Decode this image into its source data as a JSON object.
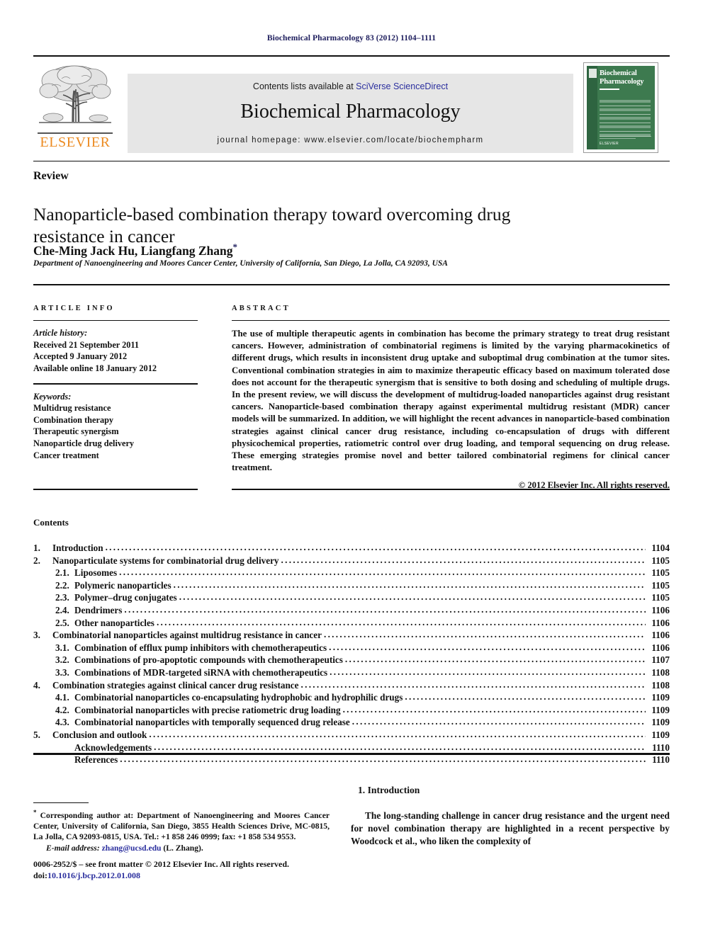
{
  "running_head": "Biochemical Pharmacology 83 (2012) 1104–1111",
  "masthead": {
    "contents_prefix": "Contents lists available at ",
    "sciencedirect_link": "SciVerse ScienceDirect",
    "journal_title": "Biochemical Pharmacology",
    "homepage": "journal homepage: www.elsevier.com/locate/biochempharm",
    "publisher_wordmark": "ELSEVIER",
    "publisher_color": "#ec8b22",
    "link_color": "#2b2f9e",
    "box_color": "#e6e6e6",
    "cover": {
      "line1": "Biochemical",
      "line2": "Pharmacology",
      "brand": "ELSEVIER",
      "bg_color": "#3d7a4f"
    }
  },
  "article": {
    "doctype": "Review",
    "title": "Nanoparticle-based combination therapy toward overcoming drug resistance in cancer",
    "authors": "Che-Ming Jack Hu, Liangfang Zhang",
    "corresponding_marker": "*",
    "affiliation": "Department of Nanoengineering and Moores Cancer Center, University of California, San Diego, La Jolla, CA 92093, USA"
  },
  "article_info": {
    "heading": "ARTICLE INFO",
    "history_label": "Article history:",
    "history": [
      "Received 21 September 2011",
      "Accepted 9 January 2012",
      "Available online 18 January 2012"
    ],
    "keywords_label": "Keywords:",
    "keywords": [
      "Multidrug resistance",
      "Combination therapy",
      "Therapeutic synergism",
      "Nanoparticle drug delivery",
      "Cancer treatment"
    ]
  },
  "abstract": {
    "heading": "ABSTRACT",
    "text": "The use of multiple therapeutic agents in combination has become the primary strategy to treat drug resistant cancers. However, administration of combinatorial regimens is limited by the varying pharmacokinetics of different drugs, which results in inconsistent drug uptake and suboptimal drug combination at the tumor sites. Conventional combination strategies in aim to maximize therapeutic efficacy based on maximum tolerated dose does not account for the therapeutic synergism that is sensitive to both dosing and scheduling of multiple drugs. In the present review, we will discuss the development of multidrug-loaded nanoparticles against drug resistant cancers. Nanoparticle-based combination therapy against experimental multidrug resistant (MDR) cancer models will be summarized. In addition, we will highlight the recent advances in nanoparticle-based combination strategies against clinical cancer drug resistance, including co-encapsulation of drugs with different physicochemical properties, ratiometric control over drug loading, and temporal sequencing on drug release. These emerging strategies promise novel and better tailored combinatorial regimens for clinical cancer treatment.",
    "copyright": "© 2012 Elsevier Inc. All rights reserved."
  },
  "contents": {
    "heading": "Contents",
    "items": [
      {
        "num": "1.",
        "level": 1,
        "label": "Introduction",
        "page": "1104"
      },
      {
        "num": "2.",
        "level": 1,
        "label": "Nanoparticulate systems for combinatorial drug delivery",
        "page": "1105"
      },
      {
        "num": "2.1.",
        "level": 2,
        "label": "Liposomes",
        "page": "1105"
      },
      {
        "num": "2.2.",
        "level": 2,
        "label": "Polymeric nanoparticles",
        "page": "1105"
      },
      {
        "num": "2.3.",
        "level": 2,
        "label": "Polymer–drug conjugates",
        "page": "1105"
      },
      {
        "num": "2.4.",
        "level": 2,
        "label": "Dendrimers",
        "page": "1106"
      },
      {
        "num": "2.5.",
        "level": 2,
        "label": "Other nanoparticles",
        "page": "1106"
      },
      {
        "num": "3.",
        "level": 1,
        "label": "Combinatorial nanoparticles against multidrug resistance in cancer",
        "page": "1106"
      },
      {
        "num": "3.1.",
        "level": 2,
        "label": "Combination of efflux pump inhibitors with chemotherapeutics",
        "page": "1106"
      },
      {
        "num": "3.2.",
        "level": 2,
        "label": "Combinations of pro-apoptotic compounds with chemotherapeutics",
        "page": "1107"
      },
      {
        "num": "3.3.",
        "level": 2,
        "label": "Combinations of MDR-targeted siRNA with chemotherapeutics",
        "page": "1108"
      },
      {
        "num": "4.",
        "level": 1,
        "label": "Combination strategies against clinical cancer drug resistance",
        "page": "1108"
      },
      {
        "num": "4.1.",
        "level": 2,
        "label": "Combinatorial nanoparticles co-encapsulating hydrophobic and hydrophilic drugs",
        "page": "1109"
      },
      {
        "num": "4.2.",
        "level": 2,
        "label": "Combinatorial nanoparticles with precise ratiometric drug loading",
        "page": "1109"
      },
      {
        "num": "4.3.",
        "level": 2,
        "label": "Combinatorial nanoparticles with temporally sequenced drug release",
        "page": "1109"
      },
      {
        "num": "5.",
        "level": 1,
        "label": "Conclusion and outlook",
        "page": "1109"
      },
      {
        "num": "",
        "level": 2,
        "label": "Acknowledgements",
        "page": "1110",
        "nodots_indent": true
      },
      {
        "num": "",
        "level": 2,
        "label": "References",
        "page": "1110",
        "nodots_indent": true
      }
    ]
  },
  "footnote": {
    "marker": "*",
    "text": " Corresponding author at: Department of Nanoengineering and Moores Cancer Center, University of California, San Diego, 3855 Health Sciences Drive, MC-0815, La Jolla, CA 92093-0815, USA. Tel.: +1 858 246 0999; fax: +1 858 534 9553.",
    "email_label": "E-mail address:",
    "email": "zhang@ucsd.edu",
    "email_suffix": " (L. Zhang).",
    "issn_line": "0006-2952/$ – see front matter © 2012 Elsevier Inc. All rights reserved.",
    "doi_label": "doi:",
    "doi": "10.1016/j.bcp.2012.01.008"
  },
  "introduction": {
    "heading": "1. Introduction",
    "paragraph": "The long-standing challenge in cancer drug resistance and the urgent need for novel combination therapy are highlighted in a recent perspective by Woodcock et al., who liken the complexity of"
  }
}
